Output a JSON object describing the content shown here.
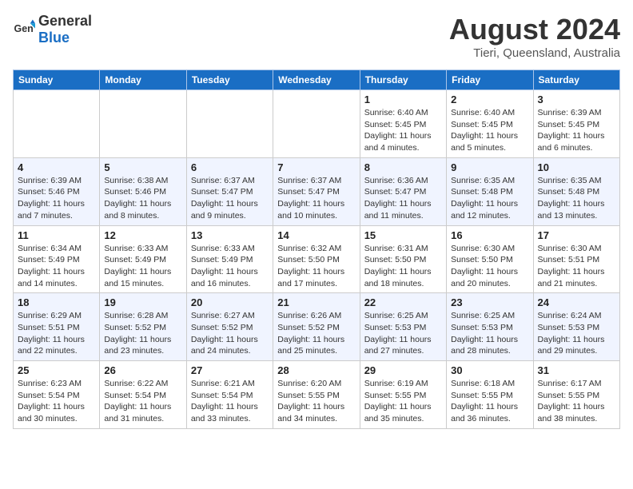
{
  "header": {
    "logo_general": "General",
    "logo_blue": "Blue",
    "month_title": "August 2024",
    "location": "Tieri, Queensland, Australia"
  },
  "days_of_week": [
    "Sunday",
    "Monday",
    "Tuesday",
    "Wednesday",
    "Thursday",
    "Friday",
    "Saturday"
  ],
  "weeks": [
    [
      {
        "day": "",
        "info": ""
      },
      {
        "day": "",
        "info": ""
      },
      {
        "day": "",
        "info": ""
      },
      {
        "day": "",
        "info": ""
      },
      {
        "day": "1",
        "info": "Sunrise: 6:40 AM\nSunset: 5:45 PM\nDaylight: 11 hours and 4 minutes."
      },
      {
        "day": "2",
        "info": "Sunrise: 6:40 AM\nSunset: 5:45 PM\nDaylight: 11 hours and 5 minutes."
      },
      {
        "day": "3",
        "info": "Sunrise: 6:39 AM\nSunset: 5:45 PM\nDaylight: 11 hours and 6 minutes."
      }
    ],
    [
      {
        "day": "4",
        "info": "Sunrise: 6:39 AM\nSunset: 5:46 PM\nDaylight: 11 hours and 7 minutes."
      },
      {
        "day": "5",
        "info": "Sunrise: 6:38 AM\nSunset: 5:46 PM\nDaylight: 11 hours and 8 minutes."
      },
      {
        "day": "6",
        "info": "Sunrise: 6:37 AM\nSunset: 5:47 PM\nDaylight: 11 hours and 9 minutes."
      },
      {
        "day": "7",
        "info": "Sunrise: 6:37 AM\nSunset: 5:47 PM\nDaylight: 11 hours and 10 minutes."
      },
      {
        "day": "8",
        "info": "Sunrise: 6:36 AM\nSunset: 5:47 PM\nDaylight: 11 hours and 11 minutes."
      },
      {
        "day": "9",
        "info": "Sunrise: 6:35 AM\nSunset: 5:48 PM\nDaylight: 11 hours and 12 minutes."
      },
      {
        "day": "10",
        "info": "Sunrise: 6:35 AM\nSunset: 5:48 PM\nDaylight: 11 hours and 13 minutes."
      }
    ],
    [
      {
        "day": "11",
        "info": "Sunrise: 6:34 AM\nSunset: 5:49 PM\nDaylight: 11 hours and 14 minutes."
      },
      {
        "day": "12",
        "info": "Sunrise: 6:33 AM\nSunset: 5:49 PM\nDaylight: 11 hours and 15 minutes."
      },
      {
        "day": "13",
        "info": "Sunrise: 6:33 AM\nSunset: 5:49 PM\nDaylight: 11 hours and 16 minutes."
      },
      {
        "day": "14",
        "info": "Sunrise: 6:32 AM\nSunset: 5:50 PM\nDaylight: 11 hours and 17 minutes."
      },
      {
        "day": "15",
        "info": "Sunrise: 6:31 AM\nSunset: 5:50 PM\nDaylight: 11 hours and 18 minutes."
      },
      {
        "day": "16",
        "info": "Sunrise: 6:30 AM\nSunset: 5:50 PM\nDaylight: 11 hours and 20 minutes."
      },
      {
        "day": "17",
        "info": "Sunrise: 6:30 AM\nSunset: 5:51 PM\nDaylight: 11 hours and 21 minutes."
      }
    ],
    [
      {
        "day": "18",
        "info": "Sunrise: 6:29 AM\nSunset: 5:51 PM\nDaylight: 11 hours and 22 minutes."
      },
      {
        "day": "19",
        "info": "Sunrise: 6:28 AM\nSunset: 5:52 PM\nDaylight: 11 hours and 23 minutes."
      },
      {
        "day": "20",
        "info": "Sunrise: 6:27 AM\nSunset: 5:52 PM\nDaylight: 11 hours and 24 minutes."
      },
      {
        "day": "21",
        "info": "Sunrise: 6:26 AM\nSunset: 5:52 PM\nDaylight: 11 hours and 25 minutes."
      },
      {
        "day": "22",
        "info": "Sunrise: 6:25 AM\nSunset: 5:53 PM\nDaylight: 11 hours and 27 minutes."
      },
      {
        "day": "23",
        "info": "Sunrise: 6:25 AM\nSunset: 5:53 PM\nDaylight: 11 hours and 28 minutes."
      },
      {
        "day": "24",
        "info": "Sunrise: 6:24 AM\nSunset: 5:53 PM\nDaylight: 11 hours and 29 minutes."
      }
    ],
    [
      {
        "day": "25",
        "info": "Sunrise: 6:23 AM\nSunset: 5:54 PM\nDaylight: 11 hours and 30 minutes."
      },
      {
        "day": "26",
        "info": "Sunrise: 6:22 AM\nSunset: 5:54 PM\nDaylight: 11 hours and 31 minutes."
      },
      {
        "day": "27",
        "info": "Sunrise: 6:21 AM\nSunset: 5:54 PM\nDaylight: 11 hours and 33 minutes."
      },
      {
        "day": "28",
        "info": "Sunrise: 6:20 AM\nSunset: 5:55 PM\nDaylight: 11 hours and 34 minutes."
      },
      {
        "day": "29",
        "info": "Sunrise: 6:19 AM\nSunset: 5:55 PM\nDaylight: 11 hours and 35 minutes."
      },
      {
        "day": "30",
        "info": "Sunrise: 6:18 AM\nSunset: 5:55 PM\nDaylight: 11 hours and 36 minutes."
      },
      {
        "day": "31",
        "info": "Sunrise: 6:17 AM\nSunset: 5:55 PM\nDaylight: 11 hours and 38 minutes."
      }
    ]
  ]
}
